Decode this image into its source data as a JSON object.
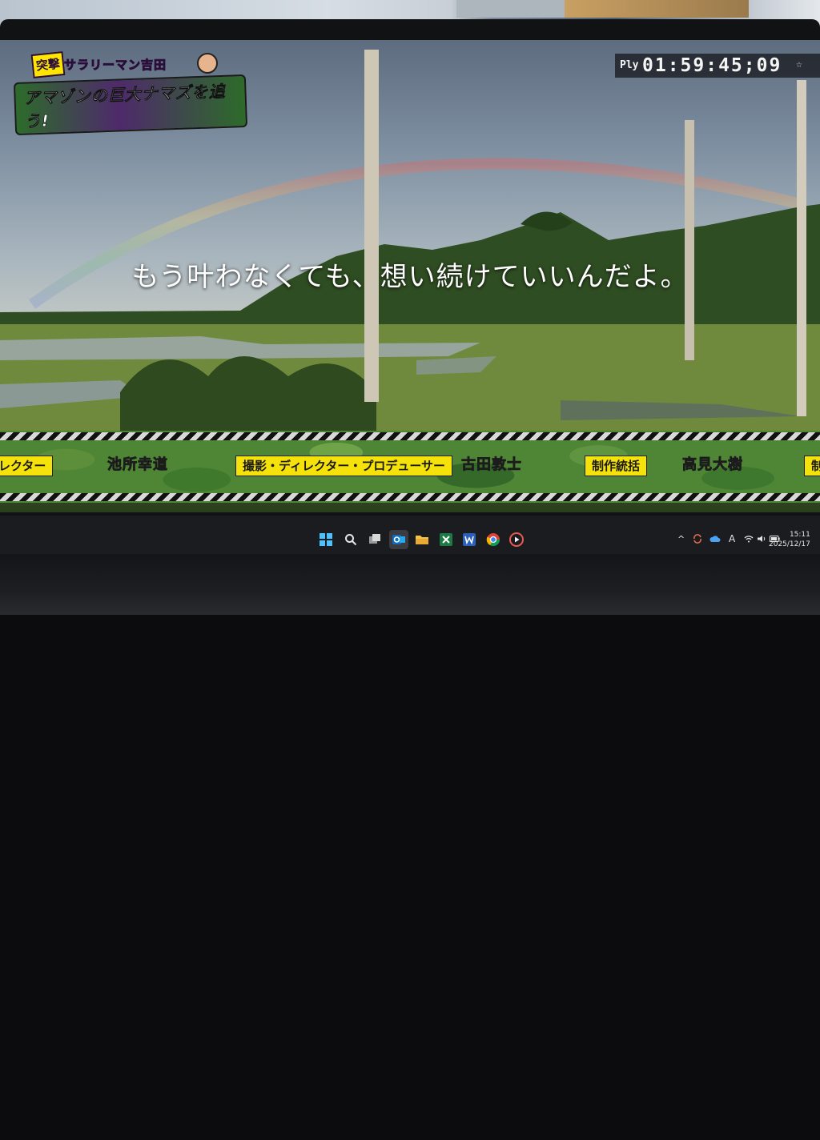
{
  "video": {
    "show_logo": {
      "line1": "サラリーマン吉田",
      "badge": "突撃",
      "line2": "アマゾンの巨大ナマズを追う!"
    },
    "timecode": {
      "mode": "Ply",
      "time": "01:59:45;09",
      "marker": "☆"
    },
    "subtitle": "もう叶わなくても、想い続けていいんだよ。",
    "credits": [
      {
        "role": "ディレクター",
        "name": "池所幸道"
      },
      {
        "role": "撮影・ディレクター・プロデューサー",
        "name": "古田敦士"
      },
      {
        "role": "制作統括",
        "name": "高見大樹"
      },
      {
        "role": "制",
        "name": ""
      }
    ]
  },
  "taskbar": {
    "apps": [
      "start-icon",
      "search-icon",
      "task-view-icon",
      "outlook-icon",
      "file-explorer-icon",
      "excel-icon",
      "word-icon",
      "chrome-icon",
      "media-player-icon"
    ],
    "tray": {
      "chevron": "^",
      "ime": "A"
    },
    "clock": {
      "time": "15:11",
      "date": "2025/12/17"
    }
  },
  "colors": {
    "credit_role_bg": "#f4e20a",
    "camo_base": "#4f8636",
    "taskbar_bg": "#1b1c1f"
  }
}
